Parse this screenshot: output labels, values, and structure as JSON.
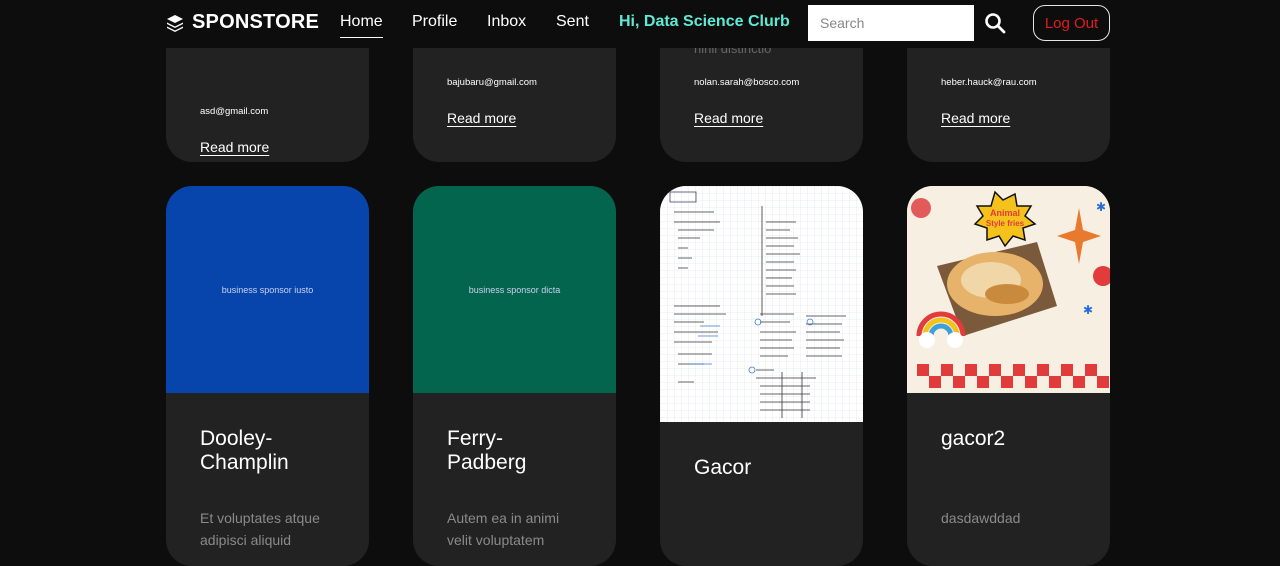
{
  "nav": {
    "brand": "SPONSTORE",
    "links": [
      "Home",
      "Profile",
      "Inbox",
      "Sent"
    ],
    "greeting": "Hi, Data Science Clurb",
    "search_placeholder": "Search",
    "logout_label": "Log Out",
    "greeting_color": "#5eead4",
    "logout_color": "#e11d1d"
  },
  "top_cards": [
    {
      "email": "asd@gmail.com",
      "read_more": "Read more",
      "faded": ""
    },
    {
      "email": "bajubaru@gmail.com",
      "read_more": "Read more",
      "faded": ""
    },
    {
      "email": "nolan.sarah@bosco.com",
      "read_more": "Read more",
      "faded": "nihil distinctio"
    },
    {
      "email": "heber.hauck@rau.com",
      "read_more": "Read more",
      "faded": ""
    }
  ],
  "cards": [
    {
      "thumb_caption": "business sponsor iusto",
      "thumb_color": "#0745ad",
      "title": "Dooley-\nChamplin",
      "desc": "Et voluptates atque\nadipisci aliquid"
    },
    {
      "thumb_caption": "business sponsor dicta",
      "thumb_color": "#04654f",
      "title": "Ferry-\nPadberg",
      "desc": "Autem ea in animi\nvelit voluptatem"
    },
    {
      "thumb_caption": "",
      "thumb_color": "#ffffff",
      "title": "Gacor",
      "desc": ""
    },
    {
      "thumb_caption": "",
      "thumb_color": "#f6efe2",
      "title": "gacor2",
      "desc": "dasdawddad",
      "sticker_text": "Animal\nStyle fries"
    }
  ]
}
